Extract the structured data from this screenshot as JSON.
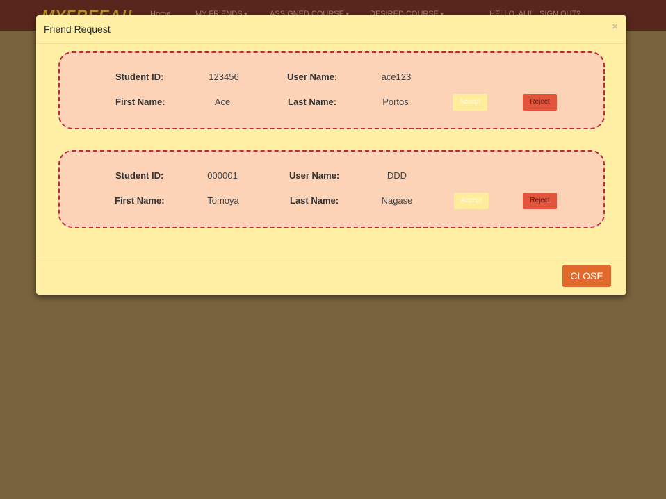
{
  "navbar": {
    "logo": "MYFREEA!!",
    "items": [
      "Home",
      "MY FRIENDS",
      "ASSIGNED COURSE",
      "DESIRED COURSE",
      "HELLO, ALI!",
      "SIGN OUT?"
    ]
  },
  "modal": {
    "title": "Friend Request",
    "close_x": "×",
    "close_button": "CLOSE"
  },
  "labels": {
    "student_id": "Student ID:",
    "user_name": "User Name:",
    "first_name": "First Name:",
    "last_name": "Last Name:",
    "accept": "Accept",
    "reject": "Reject"
  },
  "requests": [
    {
      "student_id": "123456",
      "user_name": "ace123",
      "first_name": "Ace",
      "last_name": "Portos"
    },
    {
      "student_id": "000001",
      "user_name": "DDD",
      "first_name": "Tomoya",
      "last_name": "Nagase"
    }
  ],
  "colors": {
    "page_bg": "#7f6a45",
    "navbar_bg": "#5a1f1f",
    "modal_bg": "#fff0a6",
    "card_bg": "#fdd3b8",
    "card_border": "#c0283d",
    "accept_bg": "#ffed9b",
    "reject_bg": "#e2543c",
    "close_bg": "#e0692c"
  }
}
